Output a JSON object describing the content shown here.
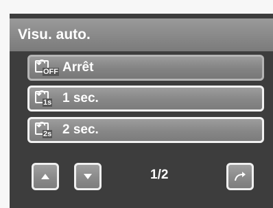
{
  "header": {
    "title": "Visu. auto."
  },
  "menu": {
    "items": [
      {
        "icon": "review-off-icon",
        "sub": "OFF",
        "label": "Arrêt",
        "selected": true
      },
      {
        "icon": "review-1s-icon",
        "sub": "1s",
        "label": "1 sec.",
        "selected": false
      },
      {
        "icon": "review-2s-icon",
        "sub": "2s",
        "label": "2 sec.",
        "selected": false
      }
    ]
  },
  "footer": {
    "page_indicator": "1/2",
    "up_icon": "up-arrow-icon",
    "down_icon": "down-arrow-icon",
    "back_icon": "return-arrow-icon"
  }
}
